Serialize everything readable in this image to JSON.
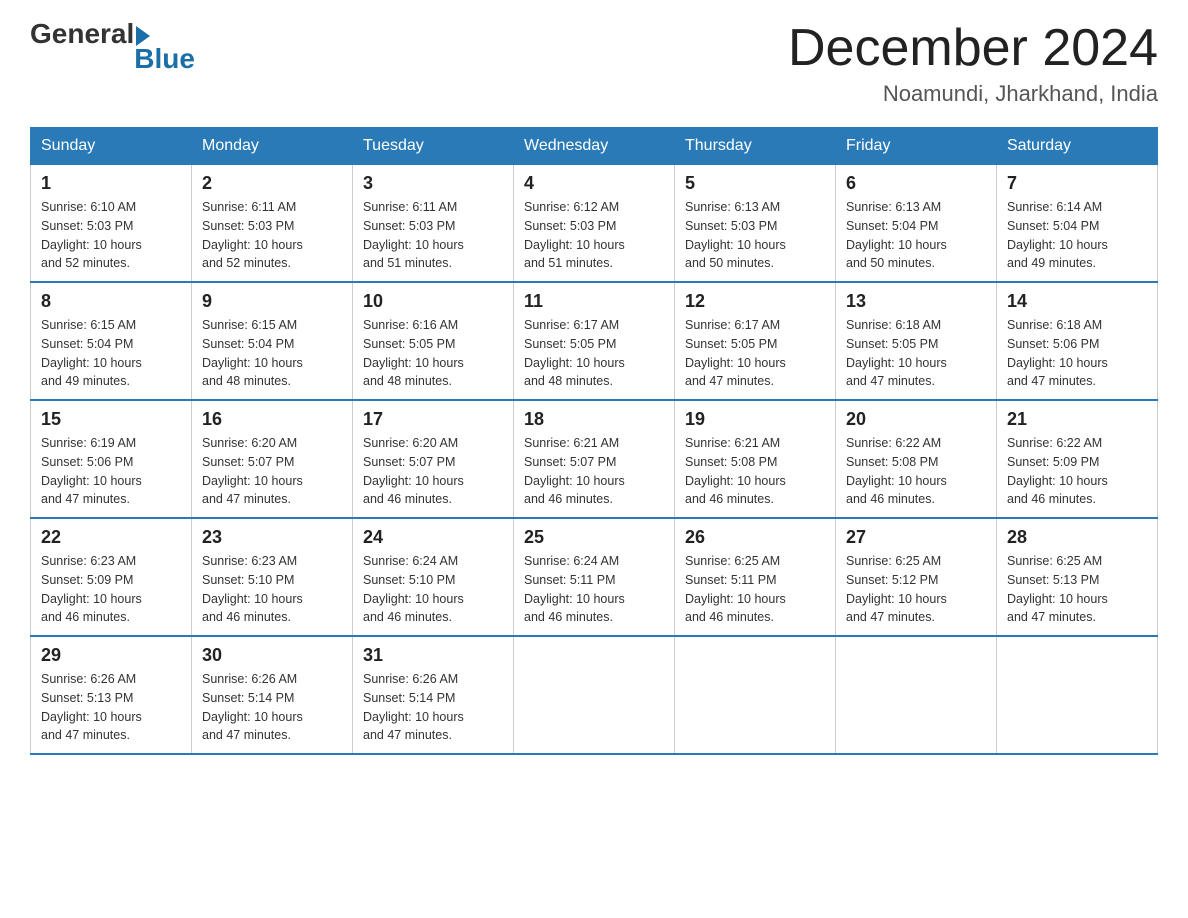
{
  "logo": {
    "general": "General",
    "blue": "Blue"
  },
  "title": "December 2024",
  "location": "Noamundi, Jharkhand, India",
  "weekdays": [
    "Sunday",
    "Monday",
    "Tuesday",
    "Wednesday",
    "Thursday",
    "Friday",
    "Saturday"
  ],
  "weeks": [
    [
      {
        "day": "1",
        "sunrise": "6:10 AM",
        "sunset": "5:03 PM",
        "daylight": "10 hours and 52 minutes."
      },
      {
        "day": "2",
        "sunrise": "6:11 AM",
        "sunset": "5:03 PM",
        "daylight": "10 hours and 52 minutes."
      },
      {
        "day": "3",
        "sunrise": "6:11 AM",
        "sunset": "5:03 PM",
        "daylight": "10 hours and 51 minutes."
      },
      {
        "day": "4",
        "sunrise": "6:12 AM",
        "sunset": "5:03 PM",
        "daylight": "10 hours and 51 minutes."
      },
      {
        "day": "5",
        "sunrise": "6:13 AM",
        "sunset": "5:03 PM",
        "daylight": "10 hours and 50 minutes."
      },
      {
        "day": "6",
        "sunrise": "6:13 AM",
        "sunset": "5:04 PM",
        "daylight": "10 hours and 50 minutes."
      },
      {
        "day": "7",
        "sunrise": "6:14 AM",
        "sunset": "5:04 PM",
        "daylight": "10 hours and 49 minutes."
      }
    ],
    [
      {
        "day": "8",
        "sunrise": "6:15 AM",
        "sunset": "5:04 PM",
        "daylight": "10 hours and 49 minutes."
      },
      {
        "day": "9",
        "sunrise": "6:15 AM",
        "sunset": "5:04 PM",
        "daylight": "10 hours and 48 minutes."
      },
      {
        "day": "10",
        "sunrise": "6:16 AM",
        "sunset": "5:05 PM",
        "daylight": "10 hours and 48 minutes."
      },
      {
        "day": "11",
        "sunrise": "6:17 AM",
        "sunset": "5:05 PM",
        "daylight": "10 hours and 48 minutes."
      },
      {
        "day": "12",
        "sunrise": "6:17 AM",
        "sunset": "5:05 PM",
        "daylight": "10 hours and 47 minutes."
      },
      {
        "day": "13",
        "sunrise": "6:18 AM",
        "sunset": "5:05 PM",
        "daylight": "10 hours and 47 minutes."
      },
      {
        "day": "14",
        "sunrise": "6:18 AM",
        "sunset": "5:06 PM",
        "daylight": "10 hours and 47 minutes."
      }
    ],
    [
      {
        "day": "15",
        "sunrise": "6:19 AM",
        "sunset": "5:06 PM",
        "daylight": "10 hours and 47 minutes."
      },
      {
        "day": "16",
        "sunrise": "6:20 AM",
        "sunset": "5:07 PM",
        "daylight": "10 hours and 47 minutes."
      },
      {
        "day": "17",
        "sunrise": "6:20 AM",
        "sunset": "5:07 PM",
        "daylight": "10 hours and 46 minutes."
      },
      {
        "day": "18",
        "sunrise": "6:21 AM",
        "sunset": "5:07 PM",
        "daylight": "10 hours and 46 minutes."
      },
      {
        "day": "19",
        "sunrise": "6:21 AM",
        "sunset": "5:08 PM",
        "daylight": "10 hours and 46 minutes."
      },
      {
        "day": "20",
        "sunrise": "6:22 AM",
        "sunset": "5:08 PM",
        "daylight": "10 hours and 46 minutes."
      },
      {
        "day": "21",
        "sunrise": "6:22 AM",
        "sunset": "5:09 PM",
        "daylight": "10 hours and 46 minutes."
      }
    ],
    [
      {
        "day": "22",
        "sunrise": "6:23 AM",
        "sunset": "5:09 PM",
        "daylight": "10 hours and 46 minutes."
      },
      {
        "day": "23",
        "sunrise": "6:23 AM",
        "sunset": "5:10 PM",
        "daylight": "10 hours and 46 minutes."
      },
      {
        "day": "24",
        "sunrise": "6:24 AM",
        "sunset": "5:10 PM",
        "daylight": "10 hours and 46 minutes."
      },
      {
        "day": "25",
        "sunrise": "6:24 AM",
        "sunset": "5:11 PM",
        "daylight": "10 hours and 46 minutes."
      },
      {
        "day": "26",
        "sunrise": "6:25 AM",
        "sunset": "5:11 PM",
        "daylight": "10 hours and 46 minutes."
      },
      {
        "day": "27",
        "sunrise": "6:25 AM",
        "sunset": "5:12 PM",
        "daylight": "10 hours and 47 minutes."
      },
      {
        "day": "28",
        "sunrise": "6:25 AM",
        "sunset": "5:13 PM",
        "daylight": "10 hours and 47 minutes."
      }
    ],
    [
      {
        "day": "29",
        "sunrise": "6:26 AM",
        "sunset": "5:13 PM",
        "daylight": "10 hours and 47 minutes."
      },
      {
        "day": "30",
        "sunrise": "6:26 AM",
        "sunset": "5:14 PM",
        "daylight": "10 hours and 47 minutes."
      },
      {
        "day": "31",
        "sunrise": "6:26 AM",
        "sunset": "5:14 PM",
        "daylight": "10 hours and 47 minutes."
      },
      null,
      null,
      null,
      null
    ]
  ],
  "labels": {
    "sunrise": "Sunrise:",
    "sunset": "Sunset:",
    "daylight": "Daylight: 10 hours"
  }
}
